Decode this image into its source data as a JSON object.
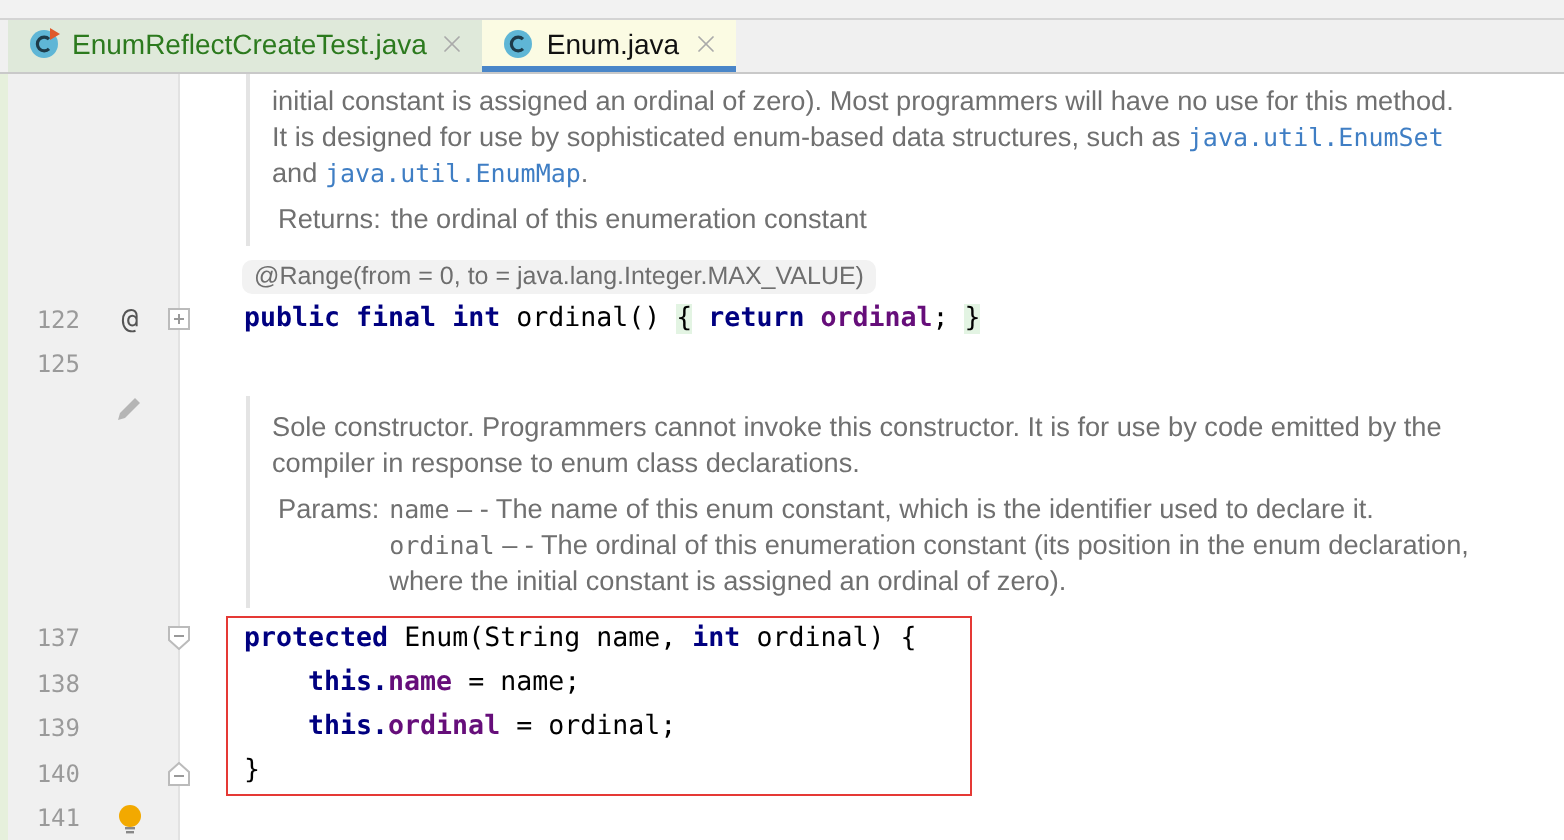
{
  "tabs": [
    {
      "label": "EnumReflectCreateTest.java",
      "selected": false,
      "modified": true,
      "run_badge": true
    },
    {
      "label": "Enum.java",
      "selected": true,
      "modified": false,
      "run_badge": false
    }
  ],
  "editor": {
    "rows": [
      {
        "kind": "doc",
        "paragraphs": [
          [
            {
              "text": "initial constant is assigned an ordinal of zero). Most programmers will have no use for this method. It is designed for use by sophisticated enum-based data structures, such as ",
              "kind": "text"
            },
            {
              "text": "java.util.EnumSet",
              "kind": "ref"
            },
            {
              "text": " and ",
              "kind": "text"
            },
            {
              "text": "java.util.EnumMap",
              "kind": "ref"
            },
            {
              "text": ".",
              "kind": "text"
            }
          ]
        ],
        "returns": {
          "label": "Returns:",
          "text": "the ordinal of this enumeration constant"
        }
      },
      {
        "kind": "annotation",
        "text": "@Range(from = 0, to = java.lang.Integer.MAX_VALUE)"
      },
      {
        "kind": "code",
        "line": "122",
        "marker": "@",
        "collapsed": true,
        "tokens": [
          {
            "text": "public final int",
            "kind": "keyword"
          },
          {
            "text": " ordinal() ",
            "kind": "plain"
          },
          {
            "text": "{",
            "kind": "brace"
          },
          {
            "text": " return ",
            "kind": "keyword"
          },
          {
            "text": "ordinal",
            "kind": "field"
          },
          {
            "text": "; ",
            "kind": "plain"
          },
          {
            "text": "}",
            "kind": "brace"
          }
        ]
      },
      {
        "kind": "blank",
        "line": "125"
      },
      {
        "kind": "doc",
        "edit_toggle": true,
        "paragraphs": [
          [
            {
              "text": "Sole constructor. Programmers cannot invoke this constructor. It is for use by code emitted by the compiler in response to enum class declarations.",
              "kind": "text"
            }
          ]
        ],
        "params": {
          "label": "Params:",
          "items": [
            {
              "name": "name",
              "text": "– - The name of this enum constant, which is the identifier used to declare it."
            },
            {
              "name": "ordinal",
              "text": "– - The ordinal of this enumeration constant (its position in the enum declaration, where the initial constant is assigned an ordinal of zero)."
            }
          ]
        }
      },
      {
        "kind": "frame",
        "lines": [
          {
            "line": "137",
            "fold_start": true,
            "tokens": [
              {
                "text": "protected",
                "kind": "keyword"
              },
              {
                "text": " Enum(String name, ",
                "kind": "plain"
              },
              {
                "text": "int",
                "kind": "keyword"
              },
              {
                "text": " ordinal) {",
                "kind": "plain"
              }
            ],
            "children": [
              {
                "line": "138",
                "tokens": [
                  {
                    "text": "this.",
                    "kind": "keyword"
                  },
                  {
                    "text": "name",
                    "kind": "field"
                  },
                  {
                    "text": " = name;",
                    "kind": "plain"
                  }
                ]
              },
              {
                "line": "139",
                "tokens": [
                  {
                    "text": "this.",
                    "kind": "keyword"
                  },
                  {
                    "text": "ordinal",
                    "kind": "field"
                  },
                  {
                    "text": " = ordinal;",
                    "kind": "plain"
                  }
                ]
              }
            ]
          },
          {
            "line": "140",
            "fold_end": true,
            "tokens": [
              {
                "text": "}",
                "kind": "plain"
              }
            ]
          }
        ]
      },
      {
        "kind": "blank",
        "line": "141",
        "intention_hint": true
      }
    ]
  }
}
